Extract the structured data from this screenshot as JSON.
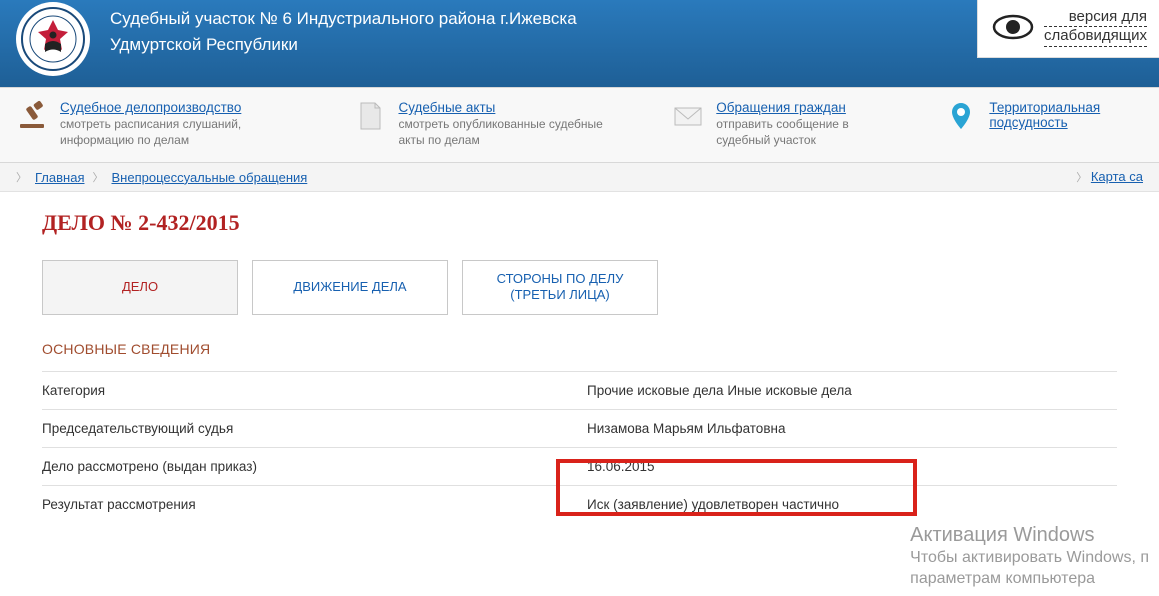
{
  "header": {
    "title_line1": "Судебный участок № 6 Индустриального района г.Ижевска",
    "title_line2": "Удмуртской Республики"
  },
  "accessibility": {
    "line1": "версия для",
    "line2": "слабовидящих"
  },
  "nav": [
    {
      "link": "Судебное делопроизводство",
      "desc": "смотреть расписания слушаний, информацию по делам"
    },
    {
      "link": "Судебные акты",
      "desc": "смотреть опубликованные судебные акты по делам"
    },
    {
      "link": "Обращения граждан",
      "desc": "отправить сообщение в судебный участок"
    },
    {
      "link": "Территориальная подсудность",
      "desc": ""
    }
  ],
  "breadcrumbs": {
    "items": [
      "Главная",
      "Внепроцессуальные обращения"
    ],
    "right": "Карта са"
  },
  "case": {
    "title": "ДЕЛО № 2-432/2015",
    "tabs": [
      "ДЕЛО",
      "ДВИЖЕНИЕ ДЕЛА",
      "СТОРОНЫ ПО ДЕЛУ (ТРЕТЬИ ЛИЦА)"
    ],
    "section": "ОСНОВНЫЕ СВЕДЕНИЯ",
    "rows": [
      {
        "label": "Категория",
        "value": "Прочие исковые дела Иные исковые дела"
      },
      {
        "label": "Председательствующий судья",
        "value": "Низамова Марьям Ильфатовна"
      },
      {
        "label": "Дело рассмотрено (выдан приказ)",
        "value": "16.06.2015"
      },
      {
        "label": "Результат рассмотрения",
        "value": "Иск (заявление) удовлетворен частично"
      }
    ]
  },
  "watermark": {
    "line1": "Активация Windows",
    "line2": "Чтобы активировать Windows, п",
    "line3": "параметрам компьютера"
  }
}
